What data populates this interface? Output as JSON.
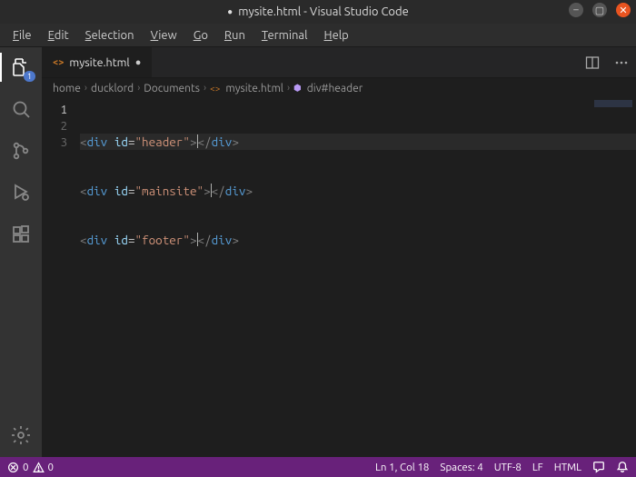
{
  "window": {
    "title": "mysite.html - Visual Studio Code",
    "modified": "●"
  },
  "menu": [
    "File",
    "Edit",
    "Selection",
    "View",
    "Go",
    "Run",
    "Terminal",
    "Help"
  ],
  "activity": {
    "explorer_badge": "1"
  },
  "tab": {
    "label": "mysite.html",
    "modified": "●"
  },
  "breadcrumb": {
    "parts": [
      "home",
      "ducklord",
      "Documents",
      "mysite.html",
      "div#header"
    ]
  },
  "code": {
    "lines": [
      {
        "n": "1",
        "tag": "div",
        "attr": "id",
        "val": "\"header\""
      },
      {
        "n": "2",
        "tag": "div",
        "attr": "id",
        "val": "\"mainsite\""
      },
      {
        "n": "3",
        "tag": "div",
        "attr": "id",
        "val": "\"footer\""
      }
    ]
  },
  "status": {
    "errors": "0",
    "warnings": "0",
    "pos": "Ln 1, Col 18",
    "spaces": "Spaces: 4",
    "encoding": "UTF-8",
    "eol": "LF",
    "language": "HTML"
  }
}
